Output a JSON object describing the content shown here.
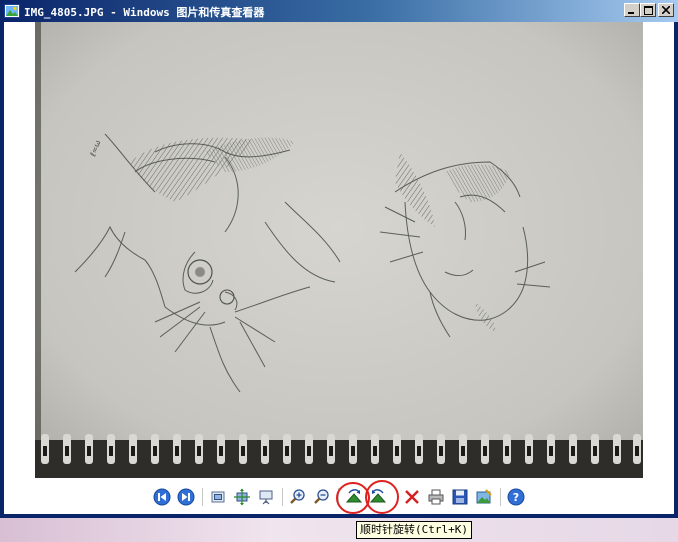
{
  "window": {
    "title": "IMG_4805.JPG - Windows 图片和传真查看器"
  },
  "colors": {
    "titlebar_dark": "#0a246a",
    "titlebar_light": "#a6caf0",
    "annotation_red": "#dd2222",
    "tooltip_bg": "#ffffe1"
  },
  "image": {
    "content": "pencil-sketch-of-two-cat-heads-on-spiral-notebook"
  },
  "toolbar": {
    "buttons": [
      {
        "name": "previous-image-button",
        "icon": "previous-icon"
      },
      {
        "name": "next-image-button",
        "icon": "next-icon"
      },
      {
        "name": "best-fit-button",
        "icon": "best-fit-icon"
      },
      {
        "name": "actual-size-button",
        "icon": "actual-size-icon"
      },
      {
        "name": "slideshow-button",
        "icon": "slideshow-icon"
      },
      {
        "name": "zoom-in-button",
        "icon": "zoom-in-icon"
      },
      {
        "name": "zoom-out-button",
        "icon": "zoom-out-icon"
      },
      {
        "name": "rotate-clockwise-button",
        "icon": "rotate-clockwise-icon"
      },
      {
        "name": "rotate-counterclockwise-button",
        "icon": "rotate-counterclockwise-icon"
      },
      {
        "name": "delete-button",
        "icon": "delete-icon"
      },
      {
        "name": "print-button",
        "icon": "print-icon"
      },
      {
        "name": "save-button",
        "icon": "save-icon"
      },
      {
        "name": "edit-button",
        "icon": "edit-icon"
      },
      {
        "name": "help-button",
        "icon": "help-icon"
      }
    ]
  },
  "tooltip": {
    "text": "顺时针旋转(Ctrl+K)"
  }
}
